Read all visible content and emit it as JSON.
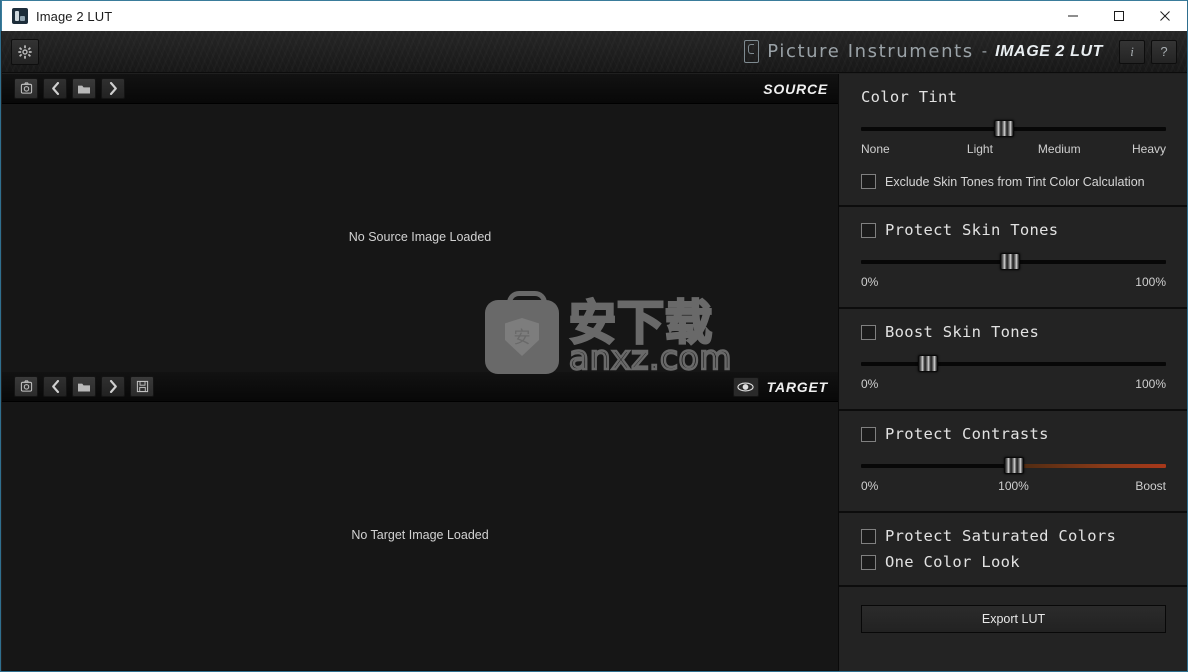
{
  "window": {
    "title": "Image 2 LUT",
    "app_icon": "app-icon",
    "controls": {
      "minimize": "minimize-icon",
      "maximize": "maximize-icon",
      "close": "close-icon"
    }
  },
  "header": {
    "settings_icon": "gear-icon",
    "logo_mark": "picture-instruments-logo",
    "brand": "Picture Instruments",
    "separator": "-",
    "product": "IMAGE 2 LUT",
    "info_button": "i",
    "help_button": "?"
  },
  "source_pane": {
    "label": "SOURCE",
    "empty_message": "No Source Image Loaded",
    "toolbar": [
      {
        "name": "load-from-clipboard-button",
        "icon": "camera-icon"
      },
      {
        "name": "previous-image-button",
        "icon": "chevron-left-icon"
      },
      {
        "name": "open-folder-button",
        "icon": "folder-icon"
      },
      {
        "name": "next-image-button",
        "icon": "chevron-right-icon"
      }
    ]
  },
  "target_pane": {
    "label": "TARGET",
    "empty_message": "No Target Image Loaded",
    "preview_toggle_icon": "eye-icon",
    "toolbar": [
      {
        "name": "load-from-clipboard-button",
        "icon": "camera-icon"
      },
      {
        "name": "previous-image-button",
        "icon": "chevron-left-icon"
      },
      {
        "name": "open-folder-button",
        "icon": "folder-icon"
      },
      {
        "name": "next-image-button",
        "icon": "chevron-right-icon"
      },
      {
        "name": "save-image-button",
        "icon": "floppy-disk-icon"
      }
    ]
  },
  "watermark": {
    "icon": "anxz-bag-shield-icon",
    "shield_glyph": "安",
    "cn_text": "安下载",
    "domain_text": "anxz.com"
  },
  "controls": {
    "color_tint": {
      "title": "Color Tint",
      "slider": {
        "value_pct": 47,
        "hot_from_pct": null
      },
      "ticks": [
        {
          "label": "None",
          "pos_pct": 0,
          "align": "left"
        },
        {
          "label": "Light",
          "pos_pct": 39,
          "align": "center"
        },
        {
          "label": "Medium",
          "pos_pct": 65,
          "align": "center"
        },
        {
          "label": "Heavy",
          "pos_pct": 100,
          "align": "right"
        }
      ],
      "checkbox": {
        "label": "Exclude Skin Tones from Tint Color Calculation",
        "checked": false
      }
    },
    "protect_skin_tones": {
      "title": "Protect Skin Tones",
      "checked": false,
      "slider": {
        "value_pct": 49
      },
      "ticks": [
        {
          "label": "0%",
          "pos_pct": 0,
          "align": "left"
        },
        {
          "label": "100%",
          "pos_pct": 100,
          "align": "right"
        }
      ]
    },
    "boost_skin_tones": {
      "title": "Boost Skin Tones",
      "checked": false,
      "slider": {
        "value_pct": 22
      },
      "ticks": [
        {
          "label": "0%",
          "pos_pct": 0,
          "align": "left"
        },
        {
          "label": "100%",
          "pos_pct": 100,
          "align": "right"
        }
      ]
    },
    "protect_contrasts": {
      "title": "Protect Contrasts",
      "checked": false,
      "slider": {
        "value_pct": 50,
        "hot_from_pct": 50,
        "hot_color": "#a8381a"
      },
      "ticks": [
        {
          "label": "0%",
          "pos_pct": 0,
          "align": "left"
        },
        {
          "label": "100%",
          "pos_pct": 50,
          "align": "center"
        },
        {
          "label": "Boost",
          "pos_pct": 100,
          "align": "right"
        }
      ]
    },
    "protect_saturated_colors": {
      "title": "Protect Saturated Colors",
      "checked": false
    },
    "one_color_look": {
      "title": "One Color Look",
      "checked": false
    },
    "export": {
      "label": "Export LUT"
    }
  },
  "theme": {
    "panel_bg": "#232323",
    "canvas_bg": "#161616",
    "titlebar_bg": "#ffffff",
    "accent_border": "#3a7c9b",
    "text": "#e2e2e2",
    "hot_track": "#a8381a"
  }
}
